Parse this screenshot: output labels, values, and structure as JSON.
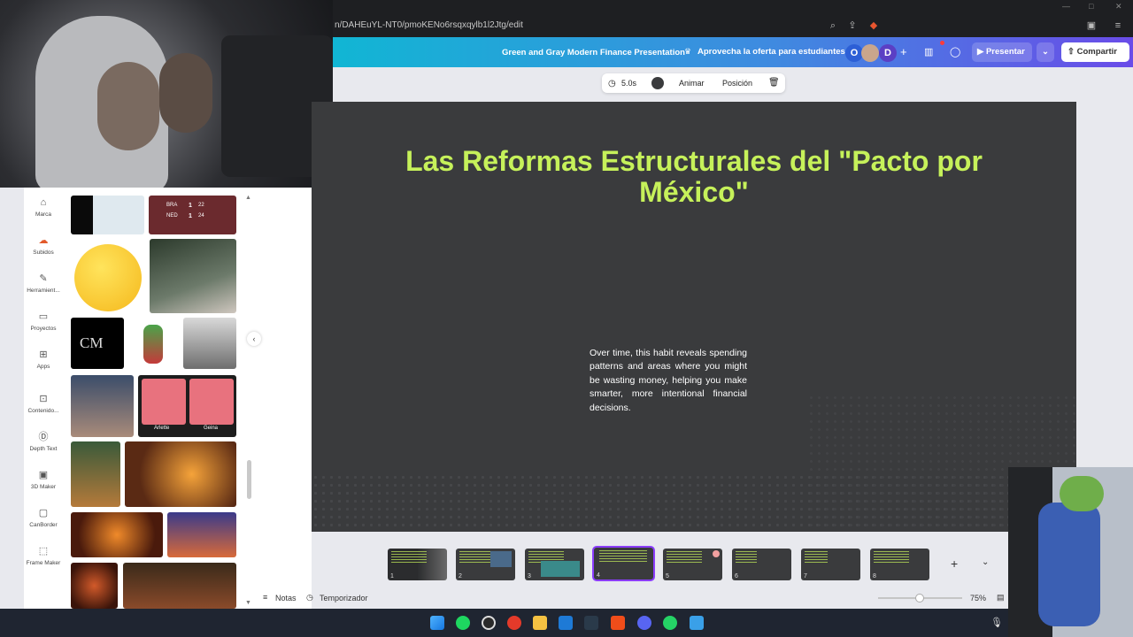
{
  "browser": {
    "url": "n/DAHEuYL-NT0/pmoKENo6rsqxqylb1l2Jtg/edit"
  },
  "header": {
    "presentation_title": "Green and Gray Modern Finance Presentation",
    "promo": "Aprovecha la oferta para estudiantes",
    "avatars": [
      "O",
      "D"
    ],
    "present_label": "Presentar",
    "share_label": "Compartir"
  },
  "toolbar": {
    "duration": "5.0s",
    "animate_label": "Animar",
    "position_label": "Posición"
  },
  "rail": {
    "items": [
      {
        "label": "Marca",
        "icon": "brand-icon"
      },
      {
        "label": "Subidos",
        "icon": "upload-cloud-icon"
      },
      {
        "label": "Herramient...",
        "icon": "pen-tool-icon"
      },
      {
        "label": "Proyectos",
        "icon": "folder-icon"
      },
      {
        "label": "Apps",
        "icon": "apps-grid-icon"
      },
      {
        "label": "Contenido...",
        "icon": "content-icon"
      },
      {
        "label": "Depth Text",
        "icon": "depth-text-icon"
      },
      {
        "label": "3D Maker",
        "icon": "3d-maker-icon"
      },
      {
        "label": "CanBorder",
        "icon": "border-icon"
      },
      {
        "label": "Frame Maker",
        "icon": "frame-icon"
      }
    ]
  },
  "uploads": {
    "cm_logo": "CM",
    "mii_names": [
      "Arlette",
      "Geina"
    ],
    "score_labels": [
      "BRA",
      "NED",
      "1",
      "1",
      "22",
      "24"
    ]
  },
  "slide": {
    "title": "Las Reformas Estructurales del \"Pacto por México\"",
    "body": "Over time, this habit reveals spending patterns and areas where you might be wasting money, helping you make smarter, more intentional financial decisions."
  },
  "thumbnails": [
    "1",
    "2",
    "3",
    "4",
    "5",
    "6",
    "7",
    "8"
  ],
  "footer": {
    "notes_label": "Notas",
    "timer_label": "Temporizador",
    "zoom": "75%"
  },
  "colors": {
    "title_green": "#c6f15a",
    "slide_bg": "#3a3b3d",
    "header_start": "#11b6d4",
    "header_end": "#6a4ce8"
  }
}
